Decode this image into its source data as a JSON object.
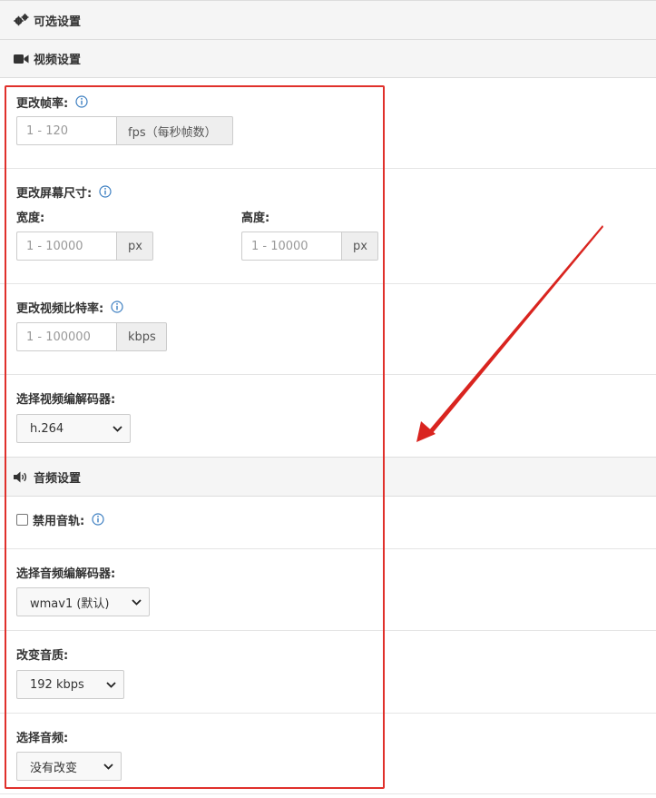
{
  "optional_settings": {
    "title": "可选设置",
    "icon": "gears-icon"
  },
  "video_settings": {
    "title": "视频设置",
    "icon": "video-camera-icon",
    "frame_rate": {
      "label": "更改帧率:",
      "placeholder": "1 - 120",
      "addon": "fps（每秒帧数）"
    },
    "screen_size": {
      "label": "更改屏幕尺寸:",
      "width": {
        "label": "宽度:",
        "placeholder": "1 - 10000",
        "addon": "px"
      },
      "height": {
        "label": "高度:",
        "placeholder": "1 - 10000",
        "addon": "px"
      }
    },
    "bitrate": {
      "label": "更改视频比特率:",
      "placeholder": "1 - 100000",
      "addon": "kbps"
    },
    "codec": {
      "label": "选择视频编解码器:",
      "selected": "h.264"
    }
  },
  "audio_settings": {
    "title": "音频设置",
    "icon": "speaker-icon",
    "disable_audio": {
      "label": "禁用音轨:"
    },
    "codec": {
      "label": "选择音频编解码器:",
      "selected": "wmav1 (默认)"
    },
    "quality": {
      "label": "改变音质:",
      "selected": "192 kbps"
    },
    "frequency": {
      "label": "选择音频:",
      "selected": "没有改变"
    }
  },
  "colors": {
    "highlight": "#e0302b",
    "info": "#3d7fc1",
    "header_bg": "#f5f5f5"
  }
}
